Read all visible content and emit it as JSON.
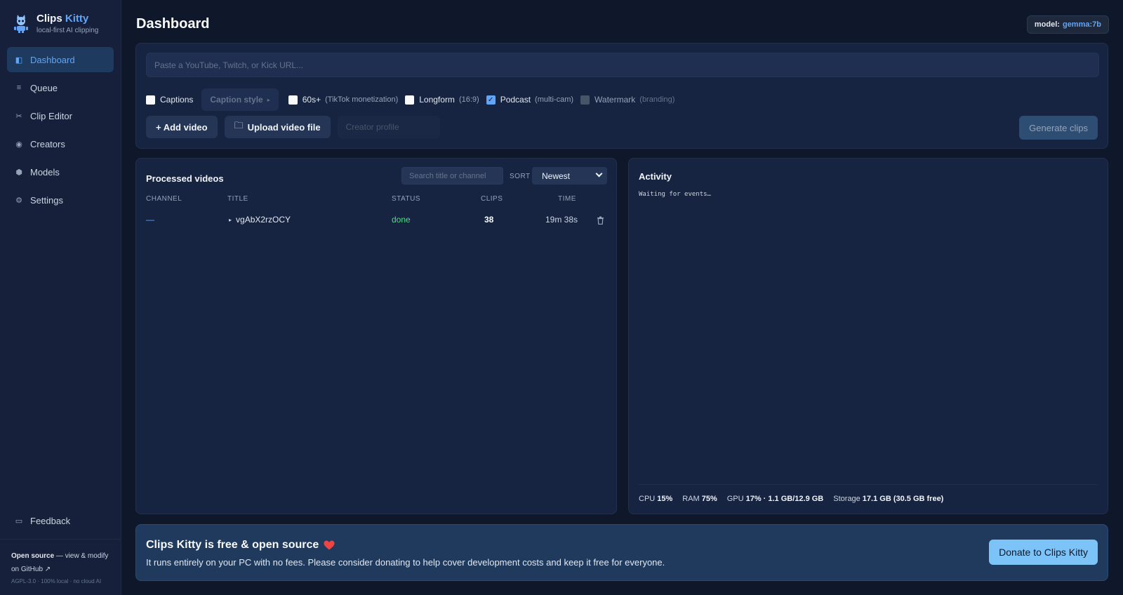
{
  "brand": {
    "title": "Clips",
    "title_accent": "Kitty",
    "subtitle": "local-first AI clipping"
  },
  "nav": [
    {
      "icon": "sidebar-panel-icon",
      "label": "Dashboard",
      "active": true
    },
    {
      "icon": "list-icon",
      "label": "Queue"
    },
    {
      "icon": "scissors-icon",
      "label": "Clip Editor"
    },
    {
      "icon": "circle-icon",
      "label": "Creators"
    },
    {
      "icon": "hexagon-icon",
      "label": "Models"
    },
    {
      "icon": "gear-icon",
      "label": "Settings"
    }
  ],
  "feedback": {
    "icon": "chat-icon",
    "label": "Feedback"
  },
  "footer": {
    "open_source": "Open source",
    "rest": " — view & modify",
    "github": "on GitHub ↗",
    "small": "AGPL-3.0 · 100% local · no cloud AI"
  },
  "header": {
    "title": "Dashboard",
    "model_label": "model:",
    "model_value": "gemma:7b"
  },
  "input": {
    "url_placeholder": "Paste a YouTube, Twitch, or Kick URL...",
    "options": [
      {
        "label": "Captions",
        "hint": "",
        "checked": false
      },
      {
        "label": "60s+",
        "hint": "(TikTok monetization)",
        "checked": false
      },
      {
        "label": "Longform",
        "hint": "(16:9)",
        "checked": false
      },
      {
        "label": "Podcast",
        "hint": "(multi-cam)",
        "checked": true
      },
      {
        "label": "Watermark",
        "hint": "(branding)",
        "checked": false,
        "disabled": true
      }
    ],
    "caption_style": "Caption style",
    "add_video": "+ Add video",
    "upload_video": "Upload video file",
    "creator_profile": "Creator profile",
    "generate": "Generate clips"
  },
  "videos": {
    "title": "Processed videos",
    "search_placeholder": "Search title or channel",
    "sort_label": "SORT",
    "sort_value": "Newest",
    "columns": [
      "CHANNEL",
      "TITLE",
      "STATUS",
      "CLIPS",
      "TIME"
    ],
    "rows": [
      {
        "channel": "—",
        "title": "vgAbX2rzOCY",
        "status": "done",
        "clips": "38",
        "time": "19m 38s"
      }
    ]
  },
  "activity": {
    "title": "Activity",
    "log": "Waiting for events…",
    "stats": [
      {
        "label": "CPU",
        "value": "15%"
      },
      {
        "label": "RAM",
        "value": "75%"
      },
      {
        "label": "GPU",
        "value": "17% · 1.1 GB/12.9 GB"
      },
      {
        "label": "Storage",
        "value": "17.1 GB (30.5 GB free)"
      }
    ]
  },
  "donate": {
    "title": "Clips Kitty is free & open source",
    "text": "It runs entirely on your PC with no fees. Please consider donating to help cover development costs and keep it free for everyone.",
    "button": "Donate to Clips Kitty"
  },
  "colors": {
    "accent": "#60a5fa",
    "bg": "#0f172a",
    "done": "#4ade80",
    "donate_button": "#7cc4f8"
  }
}
